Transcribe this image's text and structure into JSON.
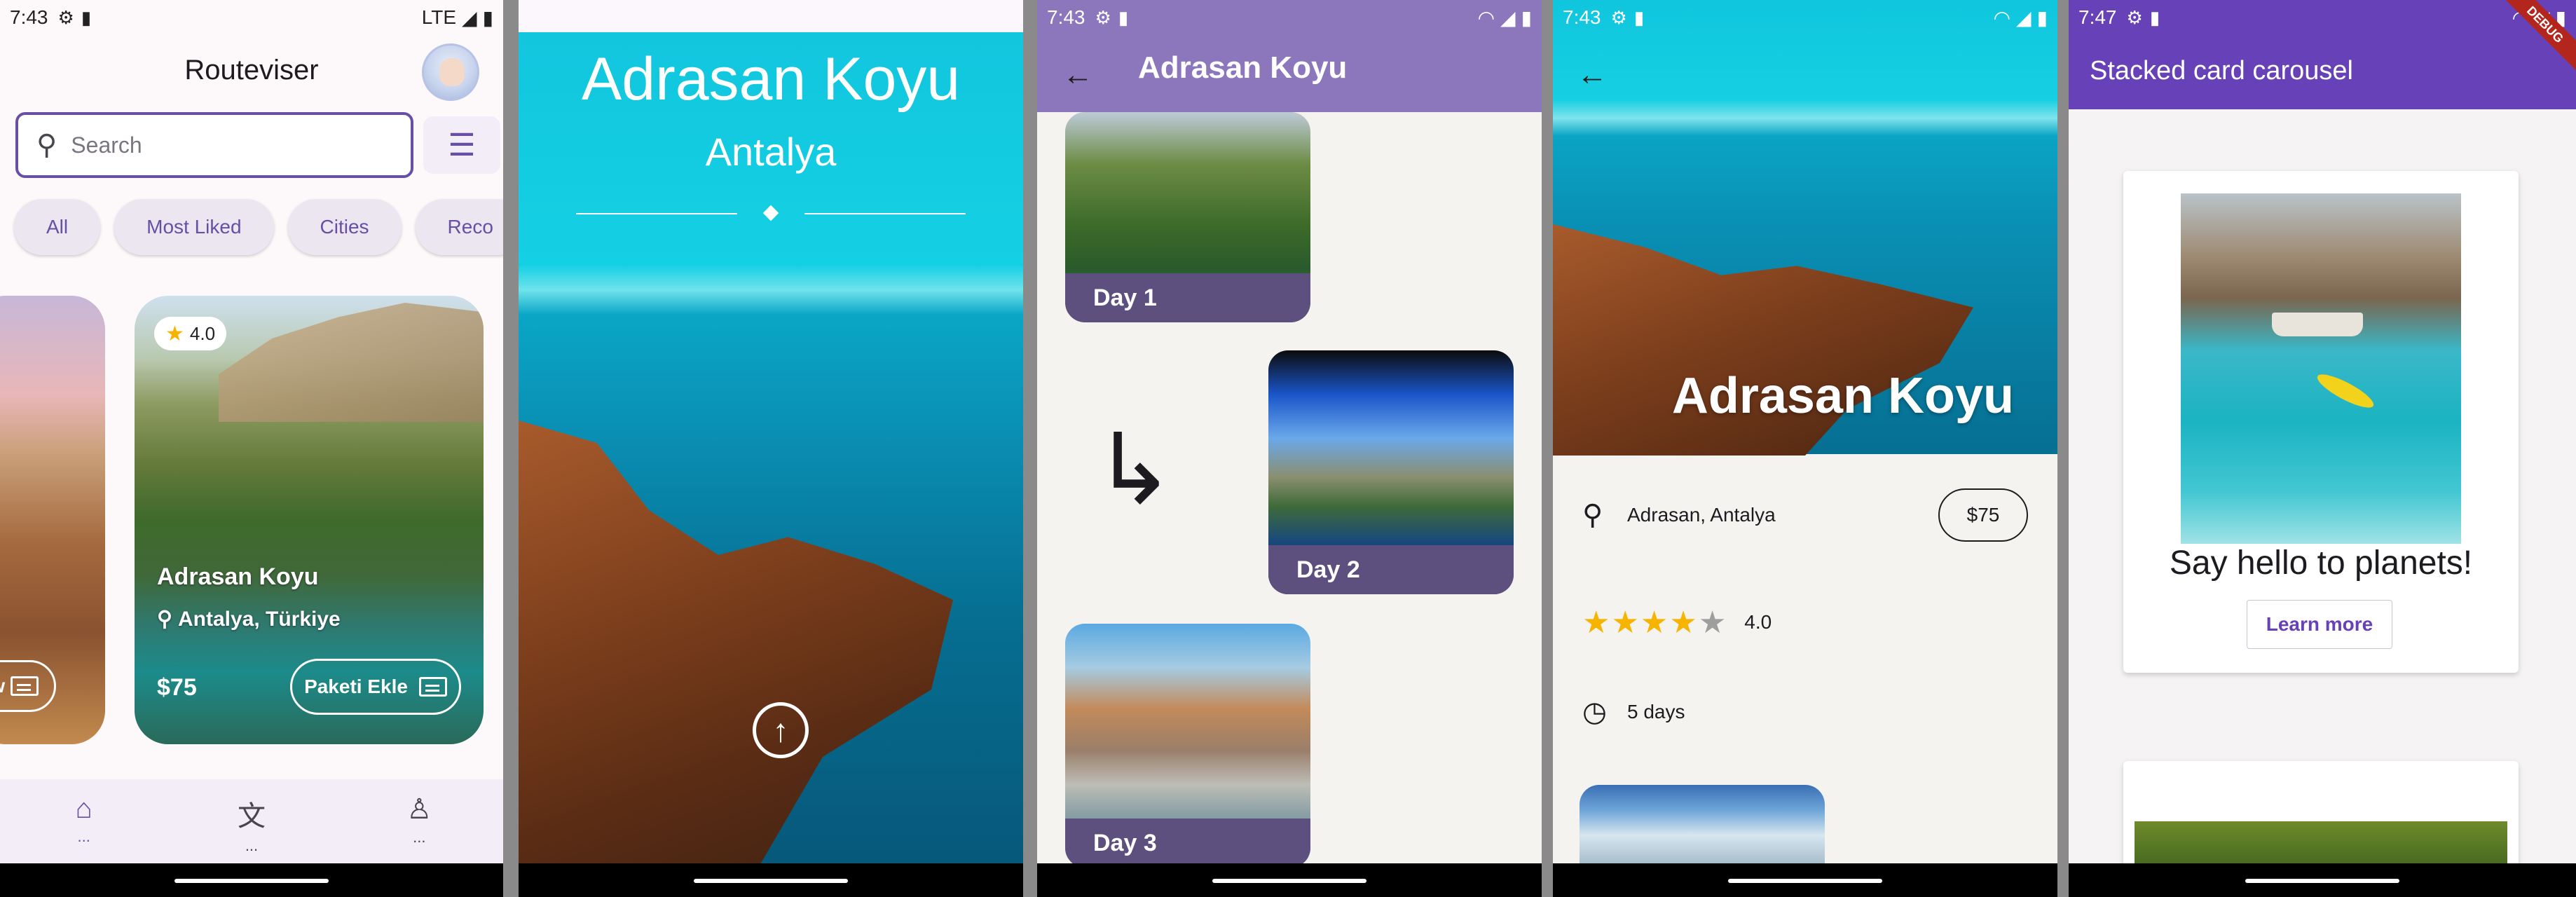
{
  "panel1": {
    "status": {
      "time": "7:43",
      "network": "LTE"
    },
    "app_title": "Routeviser",
    "search": {
      "placeholder": "Search"
    },
    "chips": [
      "All",
      "Most Liked",
      "Cities",
      "Reco"
    ],
    "left_card": {
      "button_label": "ow"
    },
    "card": {
      "rating": "4.0",
      "name": "Adrasan Koyu",
      "location": "Antalya, Türkiye",
      "price": "$75",
      "add_button": "Paketi Ekle"
    },
    "nav": [
      {
        "icon": "home-icon",
        "label": "..."
      },
      {
        "icon": "translate-icon",
        "label": "..."
      },
      {
        "icon": "person-icon",
        "label": "..."
      }
    ]
  },
  "panel2": {
    "title": "Adrasan Koyu",
    "subtitle": "Antalya"
  },
  "panel3": {
    "status": {
      "time": "7:43"
    },
    "title": "Adrasan Koyu",
    "days": [
      "Day 1",
      "Day 2",
      "Day 3"
    ]
  },
  "panel4": {
    "status": {
      "time": "7:43"
    },
    "title": "Adrasan Koyu",
    "location": "Adrasan, Antalya",
    "price": "$75",
    "rating_value": "4.0",
    "rating_stars": 4,
    "duration": "5 days"
  },
  "panel5": {
    "status": {
      "time": "7:47"
    },
    "title": "Stacked card carousel",
    "debug_banner": "DEBUG",
    "card": {
      "caption": "Say hello to planets!",
      "button": "Learn more"
    }
  },
  "colors": {
    "primary": "#6750a4",
    "appbar_purple": "#8c77bd",
    "appbar_deep": "#6741b8",
    "day_label": "#5d4f7e",
    "star": "#f6b400"
  }
}
